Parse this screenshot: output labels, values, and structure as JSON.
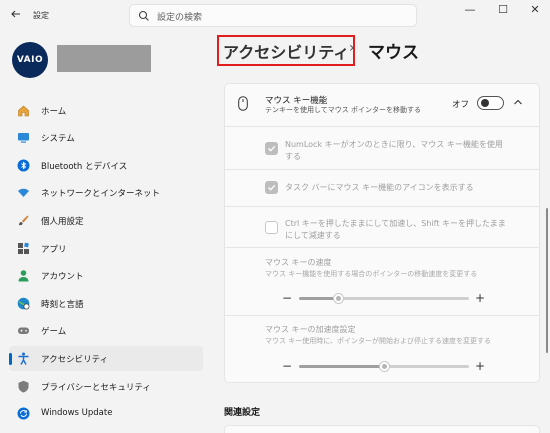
{
  "window": {
    "app_title": "設定",
    "back_icon": "back-arrow-icon",
    "minimize": "—",
    "maximize": "☐",
    "close": "✕"
  },
  "search": {
    "placeholder": "設定の検索"
  },
  "profile": {
    "avatar_text": "VAIO"
  },
  "sidebar": {
    "items": [
      {
        "label": "ホーム",
        "icon": "home-icon"
      },
      {
        "label": "システム",
        "icon": "system-icon"
      },
      {
        "label": "Bluetooth とデバイス",
        "icon": "bluetooth-icon"
      },
      {
        "label": "ネットワークとインターネット",
        "icon": "wifi-icon"
      },
      {
        "label": "個人用設定",
        "icon": "brush-icon"
      },
      {
        "label": "アプリ",
        "icon": "apps-icon"
      },
      {
        "label": "アカウント",
        "icon": "account-icon"
      },
      {
        "label": "時刻と言語",
        "icon": "globe-clock-icon"
      },
      {
        "label": "ゲーム",
        "icon": "gamepad-icon"
      },
      {
        "label": "アクセシビリティ",
        "icon": "accessibility-icon",
        "active": true
      },
      {
        "label": "プライバシーとセキュリティ",
        "icon": "shield-icon"
      },
      {
        "label": "Windows Update",
        "icon": "update-icon"
      }
    ]
  },
  "header": {
    "parent": "アクセシビリティ",
    "separator": "›",
    "title": "マウス"
  },
  "mouse_keys": {
    "title": "マウス キー機能",
    "description": "テンキーを使用してマウス ポインターを移動する",
    "toggle_state": "オフ",
    "toggle_on": false,
    "options": [
      {
        "label": "NumLock キーがオンのときに限り、マウス キー機能を使用する",
        "checked": true
      },
      {
        "label": "タスク バーにマウス キー機能のアイコンを表示する",
        "checked": true
      },
      {
        "label": "Ctrl キーを押したままにして加速し、Shift キーを押したままにして減速する",
        "checked": false
      }
    ],
    "speed": {
      "title": "マウス キーの速度",
      "description": "マウス キー機能を使用する場合のポインターの移動速度を変更する",
      "minus": "−",
      "plus": "+",
      "value_fraction": 0.23
    },
    "acceleration": {
      "title": "マウス キーの加速度設定",
      "description": "マウス キー使用時に、ポインターが開始および停止する速度を変更する",
      "minus": "−",
      "plus": "+",
      "value_fraction": 0.5
    }
  },
  "related": {
    "heading": "関連設定"
  },
  "colors": {
    "accent": "#0067c0",
    "highlight_border": "#e01e1e"
  }
}
